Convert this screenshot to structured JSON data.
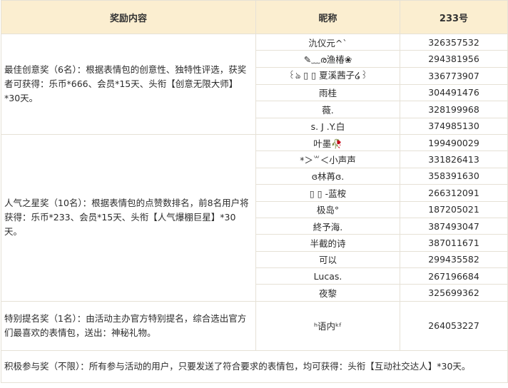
{
  "headers": {
    "reward": "奖励内容",
    "nickname": "昵称",
    "id": "233号"
  },
  "groups": [
    {
      "reward": "最佳创意奖（6名）：根据表情包的创意性、独特性评选，获奖者可获得：乐币*666、会员*15天、头衔【创意无限大师】*30天。",
      "winners": [
        {
          "nickname": "氿仪元^`",
          "id": "326357532"
        },
        {
          "nickname": "✎﹏ര渔椿❀",
          "id": "294381956"
        },
        {
          "nickname": "꒰ঌ ▯ ▯ 夏溪茜子໒꒱",
          "id": "336773907"
        },
        {
          "nickname": "雨桂",
          "id": "304491476"
        },
        {
          "nickname": "薇.",
          "id": "328199968"
        },
        {
          "nickname": "s. J .Y.白",
          "id": "374985130"
        }
      ]
    },
    {
      "reward": "人气之星奖（10名）：根据表情包的点赞数排名，前8名用户将获得：乐币*233、会员*15天、头衔【人气爆棚巨星】*30天。",
      "winners": [
        {
          "nickname": "叶墨🥀",
          "id": "199490029"
        },
        {
          "nickname": "*＞꒳＜小声声",
          "id": "331826413"
        },
        {
          "nickname": "ɞ林苒ɞ.",
          "id": "358391630"
        },
        {
          "nickname": "▯ ▯ -蓝桉",
          "id": "266312091"
        },
        {
          "nickname": "极岛°",
          "id": "187205021"
        },
        {
          "nickname": "終予海.",
          "id": "387493047"
        },
        {
          "nickname": "半截的诗",
          "id": "387011671"
        },
        {
          "nickname": "可以",
          "id": "299435582"
        },
        {
          "nickname": "Lucas.",
          "id": "267196684"
        },
        {
          "nickname": "夜黎",
          "id": "325699362"
        }
      ]
    }
  ],
  "special": {
    "reward": "特别提名奖（1名）：由活动主办官方特别提名，综合选出官方们最喜欢的表情包，送出：神秘礼物。",
    "nickname": "ʰ语内ᵏᶠ",
    "id": "264053227"
  },
  "footer": "积极参与奖（不限）：所有参与活动的用户，只要发送了符合要求的表情包，均可获得：头衔【互动社交达人】*30天。"
}
